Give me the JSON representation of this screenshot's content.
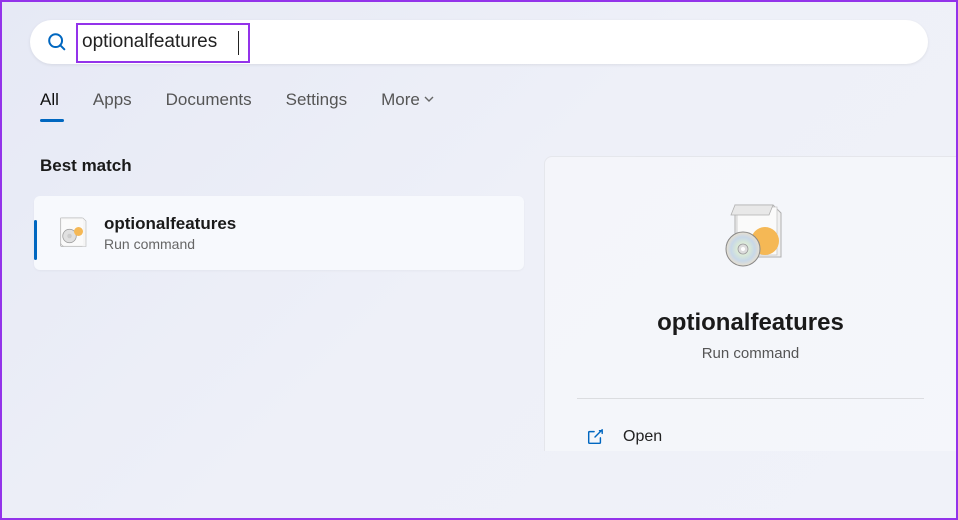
{
  "search": {
    "value": "optionalfeatures"
  },
  "tabs": {
    "items": [
      "All",
      "Apps",
      "Documents",
      "Settings",
      "More"
    ],
    "active_index": 0
  },
  "results": {
    "section_label": "Best match",
    "items": [
      {
        "title": "optionalfeatures",
        "subtitle": "Run command"
      }
    ]
  },
  "detail": {
    "title": "optionalfeatures",
    "subtitle": "Run command",
    "actions": [
      {
        "label": "Open",
        "icon": "open"
      }
    ]
  },
  "colors": {
    "accent": "#0067c0",
    "highlight": "#9333ea"
  }
}
